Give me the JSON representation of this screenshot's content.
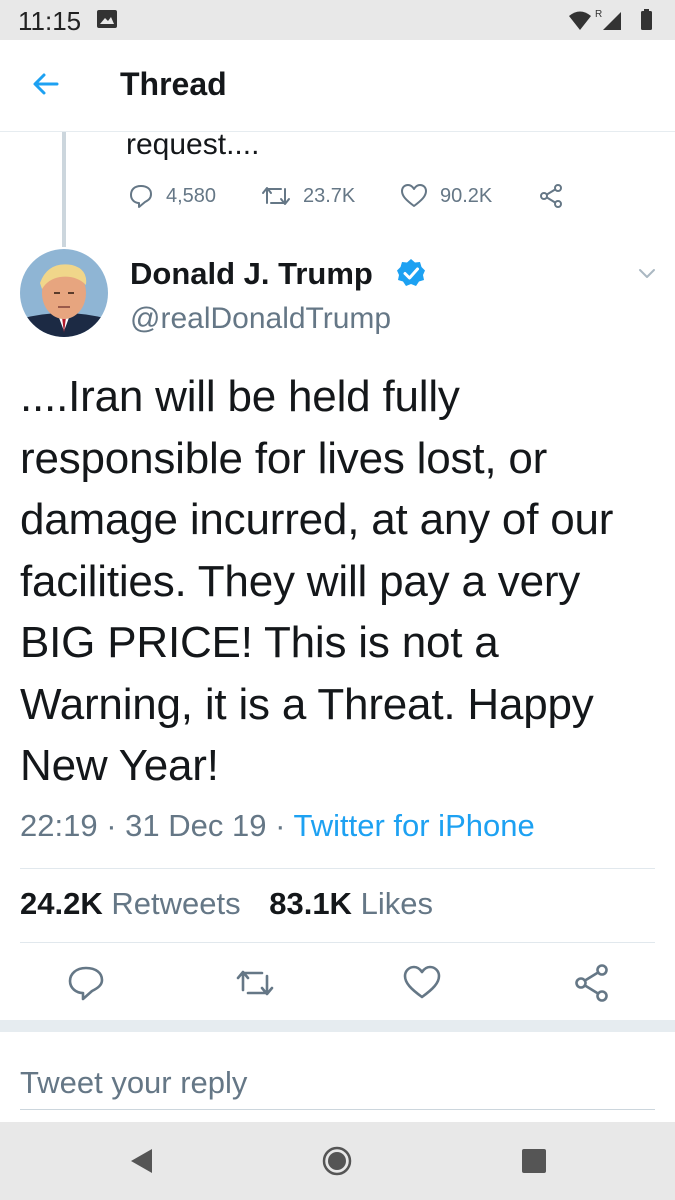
{
  "status_bar": {
    "time": "11:15",
    "icons": [
      "gallery-icon",
      "wifi-icon",
      "signal-roaming-icon",
      "battery-icon"
    ],
    "roaming_label": "R"
  },
  "appbar": {
    "title": "Thread",
    "back_icon": "arrow-left-icon"
  },
  "previous_tweet": {
    "text": "request....",
    "replies": "4,580",
    "retweets": "23.7K",
    "likes": "90.2K"
  },
  "tweet": {
    "author_name": "Donald J. Trump",
    "verified": true,
    "handle": "@realDonaldTrump",
    "text": "....Iran will be held fully responsible for lives lost, or damage incurred, at any of our facilities. They will pay a very BIG PRICE! This is not a Warning, it is a Threat. Happy New Year!",
    "time": "22:19",
    "date": "31 Dec 19",
    "source": "Twitter for iPhone",
    "retweets_count": "24.2K",
    "retweets_label": "Retweets",
    "likes_count": "83.1K",
    "likes_label": "Likes"
  },
  "reply": {
    "placeholder": "Tweet your reply"
  },
  "colors": {
    "accent": "#1da1f2",
    "secondary_text": "#657786",
    "primary_text": "#14171a",
    "divider": "#e1e8ed"
  },
  "nav": {
    "icons": [
      "back-triangle-icon",
      "home-circle-icon",
      "recents-square-icon"
    ]
  }
}
